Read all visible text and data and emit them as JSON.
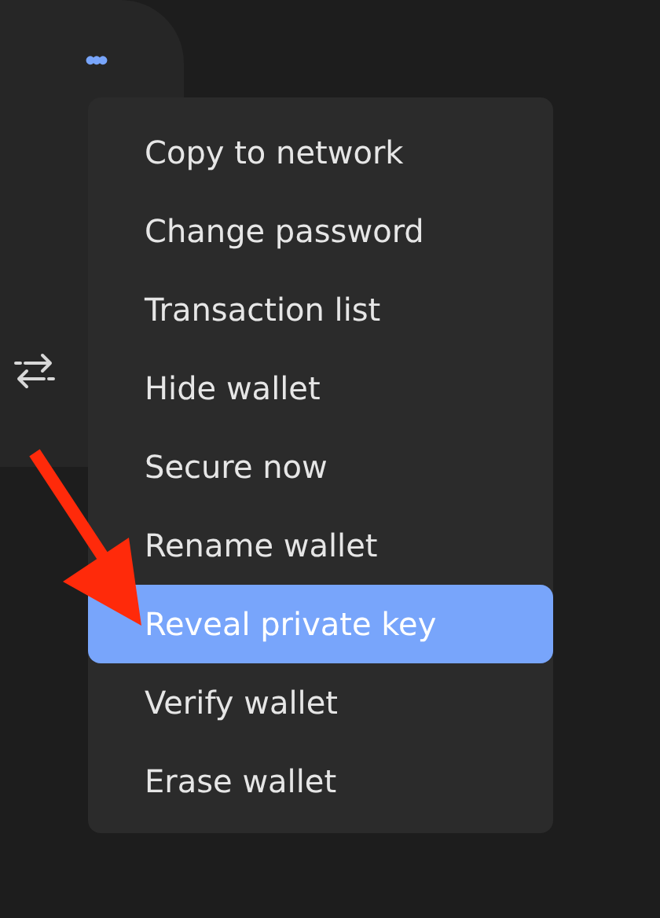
{
  "card": {
    "more_button": "•••"
  },
  "menu": {
    "items": [
      {
        "label": "Copy to network",
        "selected": false
      },
      {
        "label": "Change password",
        "selected": false
      },
      {
        "label": "Transaction list",
        "selected": false
      },
      {
        "label": "Hide wallet",
        "selected": false
      },
      {
        "label": "Secure now",
        "selected": false
      },
      {
        "label": "Rename wallet",
        "selected": false
      },
      {
        "label": "Reveal private key",
        "selected": true
      },
      {
        "label": "Verify wallet",
        "selected": false
      },
      {
        "label": "Erase wallet",
        "selected": false
      }
    ]
  }
}
